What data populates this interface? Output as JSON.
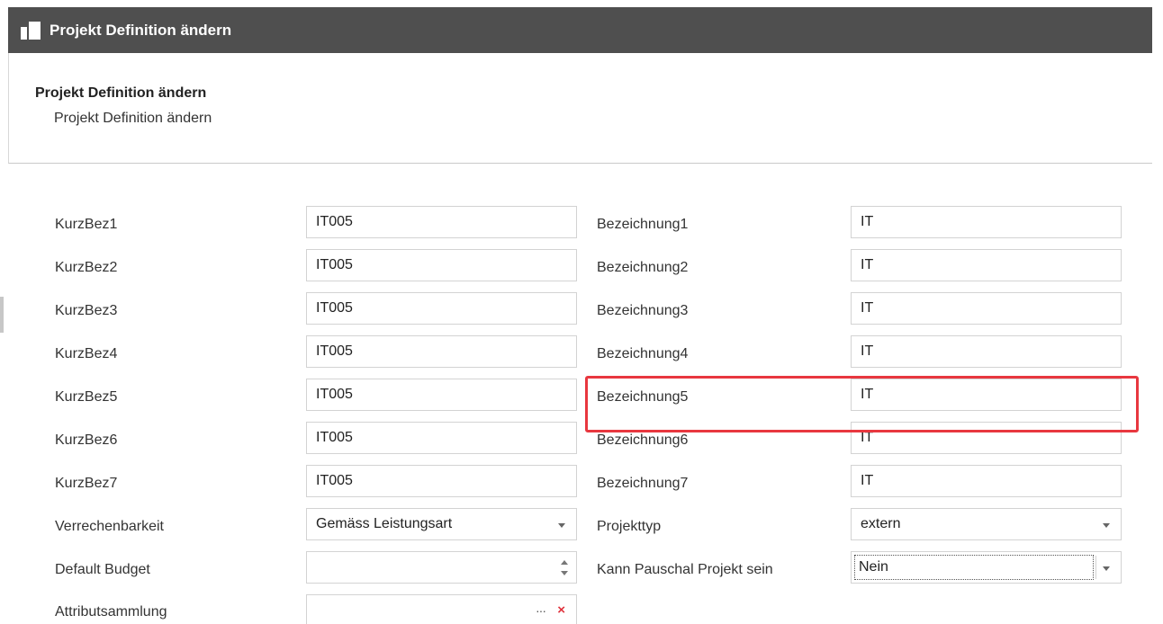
{
  "window": {
    "title": "Projekt Definition ändern"
  },
  "header": {
    "title": "Projekt Definition ändern",
    "subtitle": "Projekt Definition ändern"
  },
  "left_fields": [
    {
      "label": "KurzBez1",
      "value": "IT005"
    },
    {
      "label": "KurzBez2",
      "value": "IT005"
    },
    {
      "label": "KurzBez3",
      "value": "IT005"
    },
    {
      "label": "KurzBez4",
      "value": "IT005"
    },
    {
      "label": "KurzBez5",
      "value": "IT005"
    },
    {
      "label": "KurzBez6",
      "value": "IT005"
    },
    {
      "label": "KurzBez7",
      "value": "IT005"
    }
  ],
  "right_fields": [
    {
      "label": "Bezeichnung1",
      "value": "IT"
    },
    {
      "label": "Bezeichnung2",
      "value": "IT"
    },
    {
      "label": "Bezeichnung3",
      "value": "IT"
    },
    {
      "label": "Bezeichnung4",
      "value": "IT"
    },
    {
      "label": "Bezeichnung5",
      "value": "IT"
    },
    {
      "label": "Bezeichnung6",
      "value": "IT"
    },
    {
      "label": "Bezeichnung7",
      "value": "IT"
    }
  ],
  "verrechenbarkeit": {
    "label": "Verrechenbarkeit",
    "value": "Gemäss Leistungsart"
  },
  "projekttyp": {
    "label": "Projekttyp",
    "value": "extern"
  },
  "default_budget": {
    "label": "Default Budget",
    "value": ""
  },
  "pauschal": {
    "label": "Kann Pauschal Projekt sein",
    "value": "Nein"
  },
  "attributsammlung": {
    "label": "Attributsammlung",
    "value": "",
    "ellipsis": "···",
    "clear": "×"
  },
  "colors": {
    "titlebar": "#4f4f4f",
    "highlight": "#e8373f",
    "clear_icon": "#e0323c"
  }
}
